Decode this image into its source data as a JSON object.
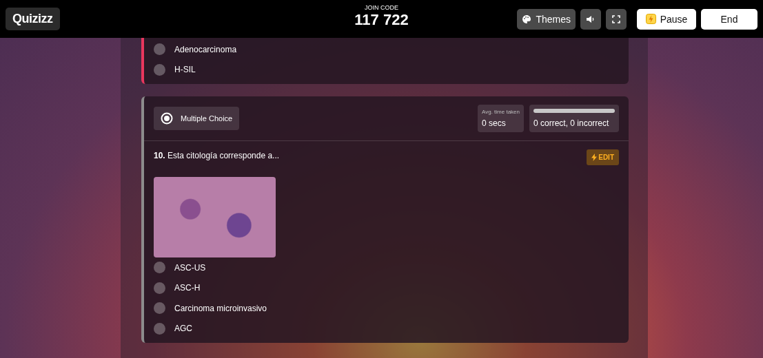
{
  "header": {
    "logo": "Quizizz",
    "join_code_label": "JOIN CODE",
    "join_code": "117 722",
    "buttons": [
      {
        "kind": "themes",
        "label": "Themes"
      },
      {
        "kind": "sound"
      },
      {
        "kind": "fullscreen"
      },
      {
        "kind": "pause",
        "label": "Pause"
      },
      {
        "kind": "end",
        "label": "End"
      }
    ]
  },
  "questions": [
    {
      "color": "#e8365d",
      "options": [
        "Adenocarcinoma",
        "H-SIL"
      ]
    },
    {
      "color": "#8c8c8c",
      "type": "Multiple Choice",
      "avg_label": "Avg. time taken",
      "avg_value": "0 secs",
      "level": 0,
      "result": "0 correct, 0 incorrect",
      "number": "10.",
      "text": "Esta citología corresponde a...",
      "edit": "EDIT",
      "has_image": true,
      "options": [
        "ASC-US",
        "ASC-H",
        "Carcinoma microinvasivo",
        "AGC"
      ]
    }
  ]
}
